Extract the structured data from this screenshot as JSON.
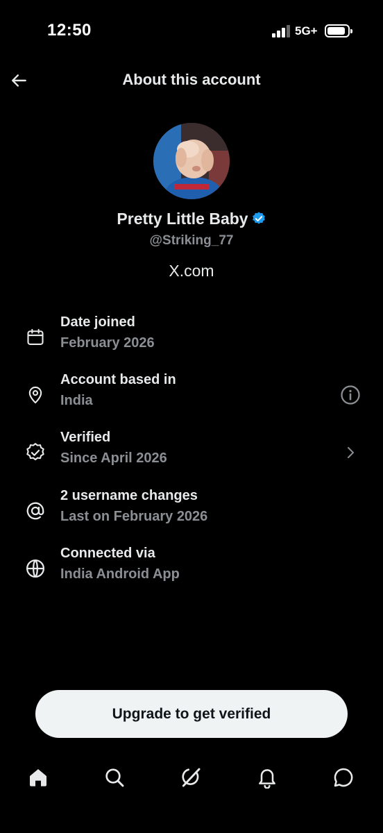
{
  "status_bar": {
    "time": "12:50",
    "network": "5G+",
    "icons": [
      "signal-icon",
      "battery-icon"
    ]
  },
  "header": {
    "title": "About this account",
    "back_icon": "arrow-left-icon"
  },
  "profile": {
    "display_name": "Pretty Little Baby",
    "handle": "@Striking_77",
    "site": "X.com",
    "verified_color": "#1d9bf0"
  },
  "info_rows": [
    {
      "icon": "calendar-icon",
      "label": "Date joined",
      "value": "February 2026"
    },
    {
      "icon": "location-pin-icon",
      "label": "Account based in",
      "value": "India",
      "action_icon": "info-icon"
    },
    {
      "icon": "verified-seal-icon",
      "label": "Verified",
      "value": "Since April 2026",
      "action_icon": "chevron-right-icon"
    },
    {
      "icon": "at-sign-icon",
      "label": "2 username changes",
      "value": "Last on February 2026"
    },
    {
      "icon": "globe-icon",
      "label": "Connected via",
      "value": "India Android App"
    }
  ],
  "upgrade_button": {
    "label": "Upgrade to get verified"
  },
  "tabbar": {
    "tabs": [
      "home-icon",
      "search-icon",
      "grok-icon",
      "notifications-icon",
      "messages-icon"
    ]
  },
  "colors": {
    "background": "#000000",
    "primary_text": "#e7e9ea",
    "secondary_text": "#8b8f94",
    "accent": "#1d9bf0",
    "button_bg": "#eff3f4"
  }
}
